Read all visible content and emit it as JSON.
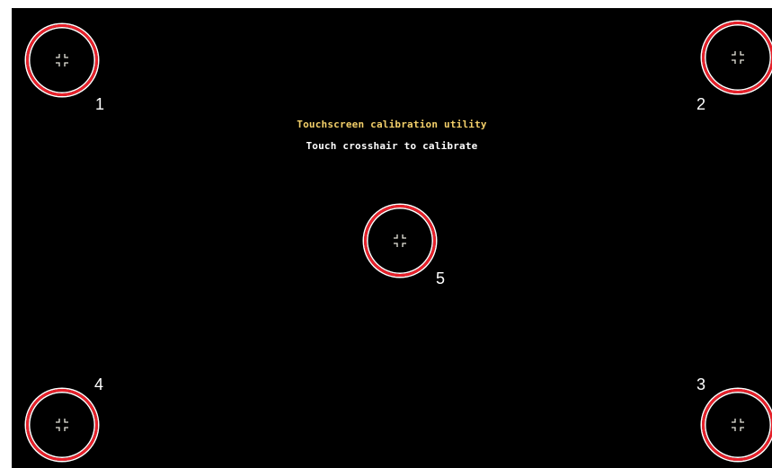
{
  "screen": {
    "title": "Touchscreen calibration utility",
    "instruction": "Touch crosshair to calibrate",
    "title_color": "#f4d06a",
    "instruction_color": "#ffffff",
    "background_color": "#000000"
  },
  "targets": [
    {
      "label": "1",
      "icon": "crosshair-icon",
      "ring_color": "#e8202a"
    },
    {
      "label": "2",
      "icon": "crosshair-icon",
      "ring_color": "#e8202a"
    },
    {
      "label": "3",
      "icon": "crosshair-icon",
      "ring_color": "#e8202a"
    },
    {
      "label": "4",
      "icon": "crosshair-icon",
      "ring_color": "#e8202a"
    },
    {
      "label": "5",
      "icon": "crosshair-icon",
      "ring_color": "#e8202a"
    }
  ]
}
